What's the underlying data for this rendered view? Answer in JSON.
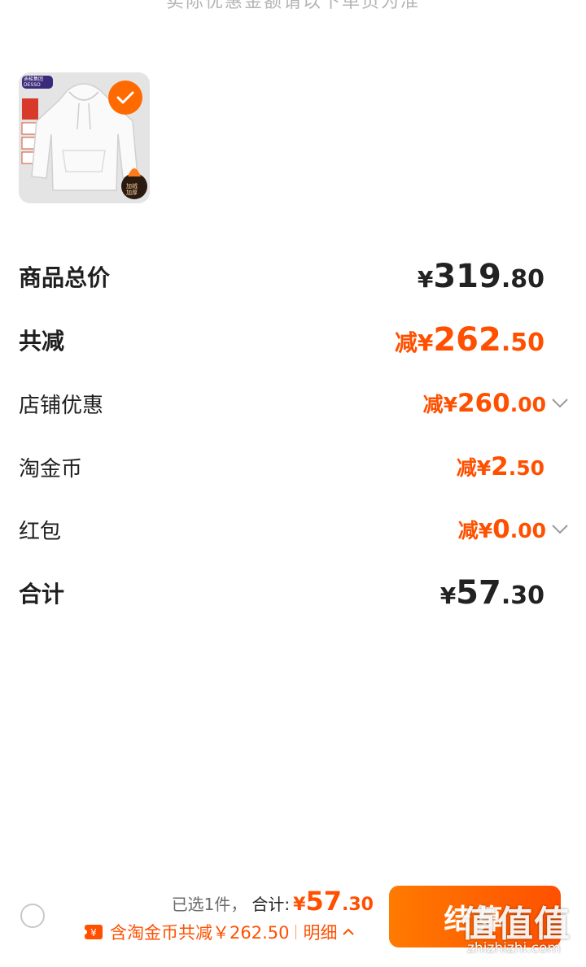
{
  "top_note": "实际优惠金额请以下单页为准",
  "product": {
    "badge_text": "迪梭集团\nDESSO",
    "corner_badge_text": "加绒\n加厚",
    "selected": true
  },
  "rows": {
    "subtotal": {
      "label": "商品总价",
      "prefix": "¥",
      "int": "319",
      "dec": ".80"
    },
    "total_discount": {
      "label": "共减",
      "prefix": "减¥",
      "int": "262",
      "dec": ".50"
    },
    "shop_discount": {
      "label": "店铺优惠",
      "prefix": "减¥",
      "int": "260",
      "dec": ".00"
    },
    "taojinbi": {
      "label": "淘金币",
      "prefix": "减¥",
      "int": "2",
      "dec": ".50"
    },
    "red_packet": {
      "label": "红包",
      "prefix": "减¥",
      "int": "0",
      "dec": ".00"
    },
    "total": {
      "label": "合计",
      "prefix": "¥",
      "int": "57",
      "dec": ".30"
    }
  },
  "bottom": {
    "selected_count": "已选1件，",
    "total_label": "合计:",
    "total_prefix": "¥",
    "total_int": "57",
    "total_dec": ".30",
    "coin_text": "含淘金币共减￥262.50",
    "detail_label": "明细",
    "checkout_label": "结算"
  },
  "watermark": {
    "main": "值值值",
    "sub": "zhizhizhi.com"
  },
  "colors": {
    "accent": "#ff5000",
    "text": "#1f1f1f"
  }
}
